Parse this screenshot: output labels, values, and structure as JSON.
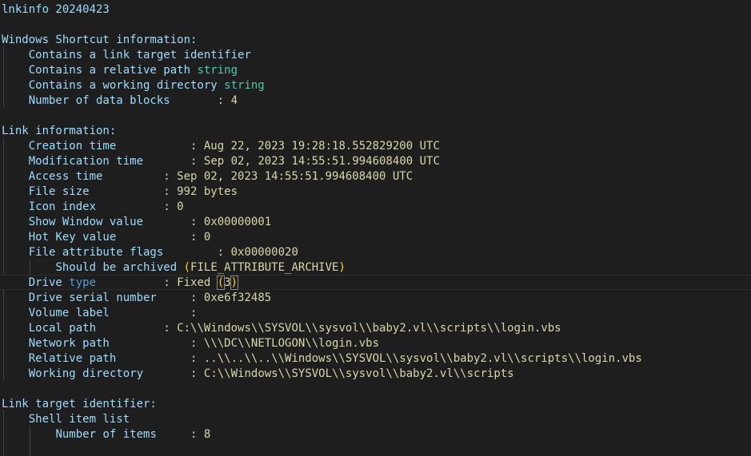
{
  "title": "lnkinfo 20240423",
  "shortcut": {
    "heading": "Windows Shortcut information:",
    "link_target_prefix": "Contains a link target identifier",
    "relative_prefix": "Contains a relative path ",
    "relative_word": "string",
    "working_prefix": "Contains a working directory ",
    "working_word": "string",
    "blocks_label": "Number of data blocks",
    "blocks_sep": ": ",
    "blocks_value": "4"
  },
  "link": {
    "heading": "Link information:",
    "creation_label": "Creation time",
    "creation_value": "Aug 22, 2023 19:28:18.552829200 UTC",
    "modification_label": "Modification time",
    "modification_value": "Sep 02, 2023 14:55:51.994608400 UTC",
    "access_label": "Access time",
    "access_value": "Sep 02, 2023 14:55:51.994608400 UTC",
    "filesize_label": "File size",
    "filesize_value": "992 bytes",
    "icon_label": "Icon index",
    "icon_value": "0",
    "showwindow_label": "Show Window value",
    "showwindow_value": "0x00000001",
    "hotkey_label": "Hot Key value",
    "hotkey_value": "0",
    "fileattr_label": "File attribute flags",
    "fileattr_value": "0x00000020",
    "archived_text": "Should be archived ",
    "archived_paren_open": "(",
    "archived_flag": "FILE_ATTRIBUTE_ARCHIVE",
    "archived_paren_close": ")",
    "drive_label_a": "Drive ",
    "drive_label_b": "type",
    "drive_value": "Fixed ",
    "drive_paren_open": "(",
    "drive_code": "3",
    "drive_paren_close": ")",
    "serial_label": "Drive serial number",
    "serial_value": "0xe6f32485",
    "volume_label": "Volume label",
    "local_label": "Local path",
    "local_value": "C:\\\\Windows\\\\SYSVOL\\\\sysvol\\\\baby2.vl\\\\scripts\\\\login.vbs",
    "network_label": "Network path",
    "network_value": "\\\\\\DC\\\\NETLOGON\\\\login.vbs",
    "relative_label": "Relative path",
    "relative_value": "..\\\\..\\\\..\\\\Windows\\\\SYSVOL\\\\sysvol\\\\baby2.vl\\\\scripts\\\\login.vbs",
    "workdir_label": "Working directory",
    "workdir_value": "C:\\\\Windows\\\\SYSVOL\\\\sysvol\\\\baby2.vl\\\\scripts"
  },
  "target": {
    "heading": "Link target identifier:",
    "shell_label": "Shell item list",
    "items_label": "Number of items",
    "items_value": "8"
  },
  "colors": {
    "background": "#1e1e1e",
    "key": "#9cdcfe",
    "value": "#d7d7a9",
    "keyword": "#569cd6",
    "type_word": "#4ec9b0",
    "bracket": "#ffd700"
  }
}
